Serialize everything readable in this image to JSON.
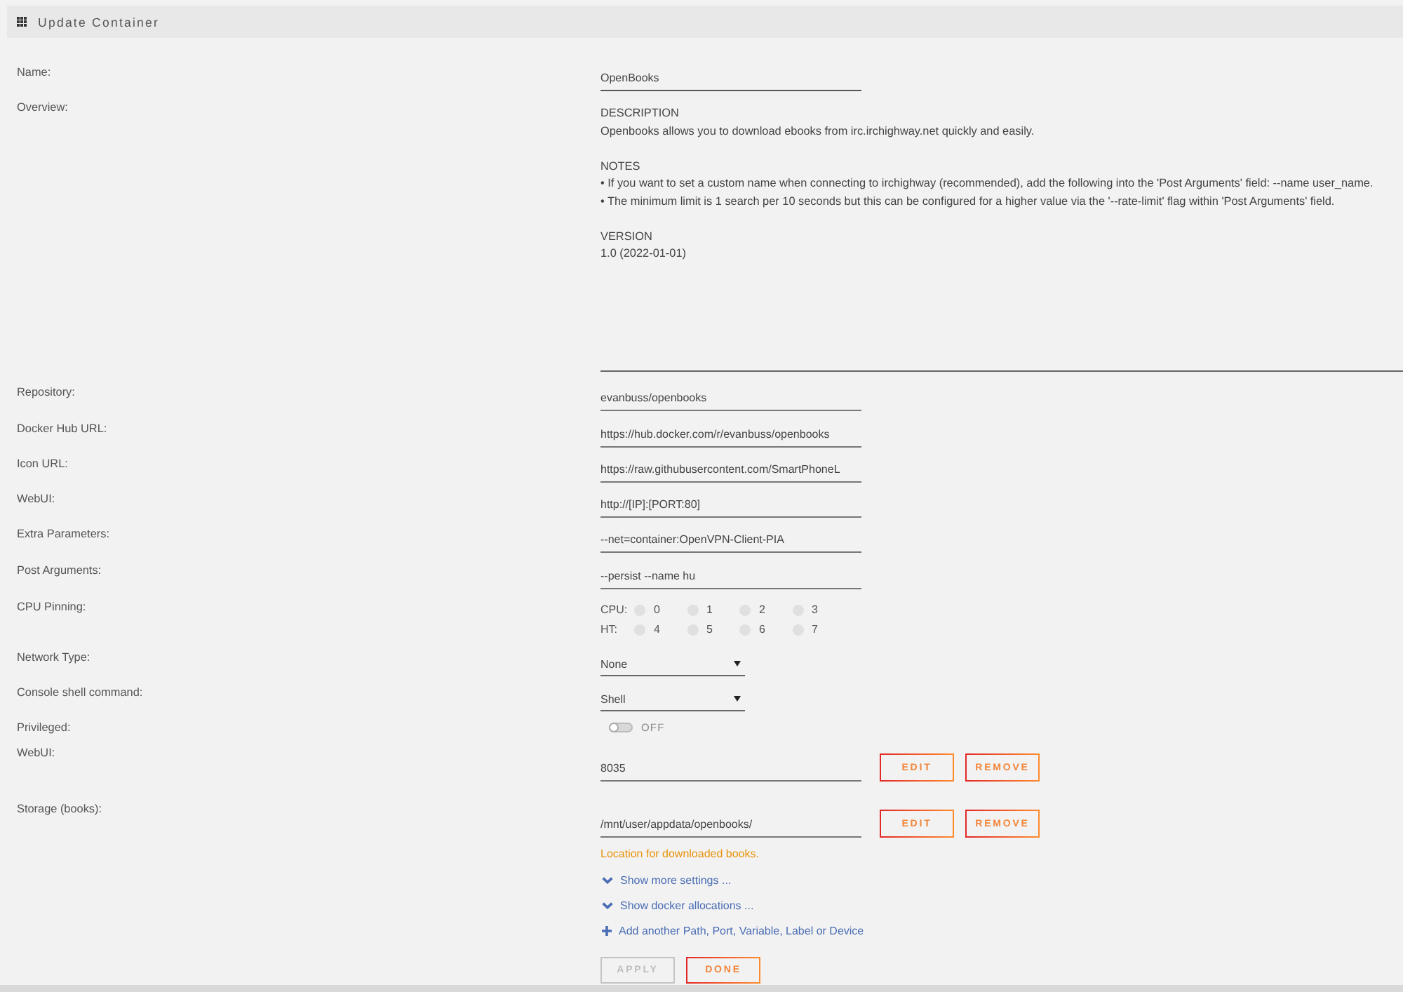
{
  "header": {
    "title": "Update Container"
  },
  "fields": [
    {
      "kind": "text",
      "label": "Name:",
      "value": "OpenBooks"
    },
    {
      "kind": "textarea",
      "label": "Overview:",
      "value": "DESCRIPTION\nOpenbooks allows you to download ebooks from irc.irchighway.net quickly and easily.\n\nNOTES\n• If you want to set a custom name when connecting to irchighway (recommended), add the following into the 'Post Arguments' field: --name user_name.\n• The minimum limit is 1 search per 10 seconds but this can be configured for a higher value via the '--rate-limit' flag within 'Post Arguments' field.\n\nVERSION\n1.0 (2022-01-01)"
    },
    {
      "kind": "text",
      "label": "Repository:",
      "value": "evanbuss/openbooks"
    },
    {
      "kind": "text",
      "label": "Docker Hub URL:",
      "value": "https://hub.docker.com/r/evanbuss/openbooks"
    },
    {
      "kind": "text",
      "label": "Icon URL:",
      "value": "https://raw.githubusercontent.com/SmartPhoneL"
    },
    {
      "kind": "text",
      "label": "WebUI:",
      "value": "http://[IP]:[PORT:80]"
    },
    {
      "kind": "text",
      "label": "Extra Parameters:",
      "value": "--net=container:OpenVPN-Client-PIA"
    },
    {
      "kind": "text",
      "label": "Post Arguments:",
      "value": "--persist --name hu"
    },
    {
      "kind": "cpu",
      "label": "CPU Pinning:",
      "groups": [
        {
          "label": "CPU:",
          "cores": [
            {
              "number": "0",
              "checked": false
            },
            {
              "number": "1",
              "checked": false
            },
            {
              "number": "2",
              "checked": false
            },
            {
              "number": "3",
              "checked": false
            }
          ]
        },
        {
          "label": "HT:",
          "cores": [
            {
              "number": "4",
              "checked": false
            },
            {
              "number": "5",
              "checked": false
            },
            {
              "number": "6",
              "checked": false
            },
            {
              "number": "7",
              "checked": false
            }
          ]
        }
      ]
    },
    {
      "kind": "select",
      "label": "Network Type:",
      "value": "None"
    },
    {
      "kind": "select",
      "label": "Console shell command:",
      "value": "Shell"
    },
    {
      "kind": "toggle",
      "label": "Privileged:",
      "on": false,
      "state_text": "OFF"
    },
    {
      "kind": "mapping",
      "label": "WebUI:",
      "value": "8035",
      "buttons": [
        "EDIT",
        "REMOVE"
      ]
    },
    {
      "kind": "mapping",
      "label": "Storage (books):",
      "value": "/mnt/user/appdata/openbooks/",
      "buttons": [
        "EDIT",
        "REMOVE"
      ],
      "description": "Location for downloaded books."
    }
  ],
  "links": [
    {
      "kind": "expand",
      "text": "Show more settings ..."
    },
    {
      "kind": "expand",
      "text": "Show docker allocations ..."
    },
    {
      "kind": "add",
      "text": "Add another Path, Port, Variable, Label or Device"
    }
  ],
  "actions": [
    {
      "label": "APPLY",
      "disabled": true
    },
    {
      "label": "DONE",
      "disabled": false
    }
  ]
}
